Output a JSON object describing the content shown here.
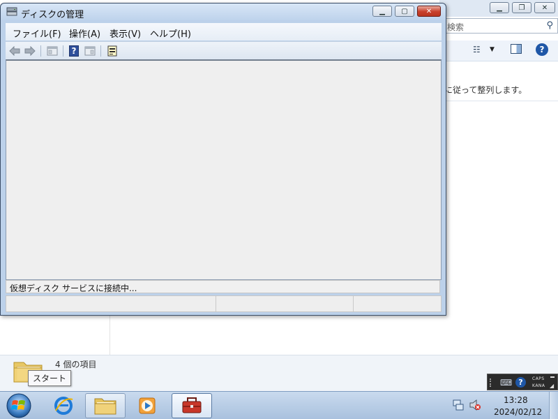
{
  "explorer": {
    "search_placeholder": "検索",
    "arrange_hint": "に従って整列します。",
    "item_count": "4 個の項目"
  },
  "tooltip": {
    "text": "スタート"
  },
  "disk_management": {
    "title": "ディスクの管理",
    "menu": [
      "ファイル(F)",
      "操作(A)",
      "表示(V)",
      "ヘルプ(H)"
    ],
    "status_message": "仮想ディスク サービスに接続中..."
  },
  "taskbar": {
    "time": "13:28",
    "date": "2024/02/12"
  },
  "language_bar": {
    "caps": "CAPS",
    "kana": "KANA"
  },
  "colors": {
    "title_bar": "#bed3ec",
    "close_button": "#c8402b",
    "content_background": "#efefef",
    "taskbar": "#b9cde5"
  }
}
